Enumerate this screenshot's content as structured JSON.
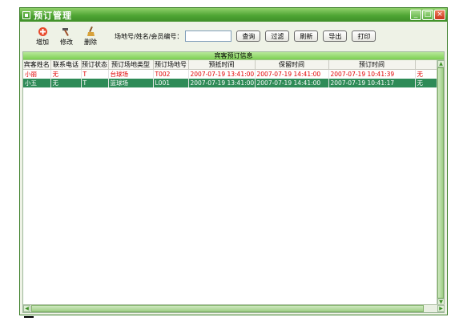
{
  "window": {
    "title": "预订管理",
    "min_glyph": "_",
    "max_glyph": "□",
    "close_glyph": "×"
  },
  "toolbar": {
    "add_label": "增加",
    "edit_label": "修改",
    "delete_label": "删除",
    "search_label": "场地号/姓名/会员编号：",
    "search_value": "",
    "query_label": "查询",
    "filter_label": "过滤",
    "refresh_label": "刷新",
    "export_label": "导出",
    "print_label": "打印"
  },
  "grid": {
    "caption": "宾客预订信息",
    "columns": [
      "宾客姓名",
      "联系电话",
      "预订状态",
      "预订场地类型",
      "预订场地号",
      "预抵时间",
      "保留时间",
      "预订时间",
      ""
    ],
    "rows": [
      [
        "小丽",
        "无",
        "T",
        "台球场",
        "T002",
        "2007-07-19 13:41:00",
        "2007-07-19 14:41:00",
        "2007-07-19 10:41:39",
        "无"
      ],
      [
        "小五",
        "无",
        "T",
        "篮球场",
        "L001",
        "2007-07-19 13:41:00",
        "2007-07-19 14:41:00",
        "2007-07-19 10:41:17",
        "无"
      ]
    ]
  },
  "colors": {
    "accent": "#4fa534",
    "selected_row": "#2e8b57",
    "text_red": "#e00000"
  }
}
